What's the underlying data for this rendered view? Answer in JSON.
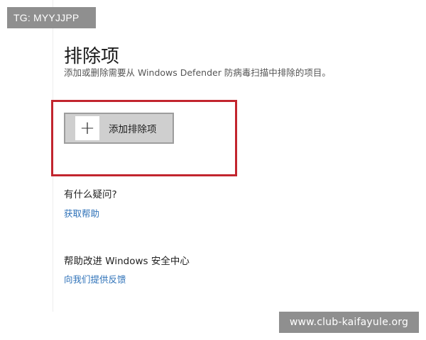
{
  "watermarks": {
    "top_label": "TG: MYYJJPP",
    "bottom_label": "www.club-kaifayule.org"
  },
  "page": {
    "title": "排除项",
    "description": "添加或删除需要从 Windows Defender 防病毒扫描中排除的项目。"
  },
  "exclusions": {
    "add_icon": "plus-icon",
    "add_glyph": "+",
    "add_label": "添加排除项",
    "highlight_color": "#c2252e"
  },
  "help": {
    "heading": "有什么疑问?",
    "link_label": "获取帮助"
  },
  "feedback": {
    "heading": "帮助改进 Windows 安全中心",
    "link_label": "向我们提供反馈"
  },
  "colors": {
    "link": "#2d71b8",
    "button_background": "#cfcfcf"
  }
}
